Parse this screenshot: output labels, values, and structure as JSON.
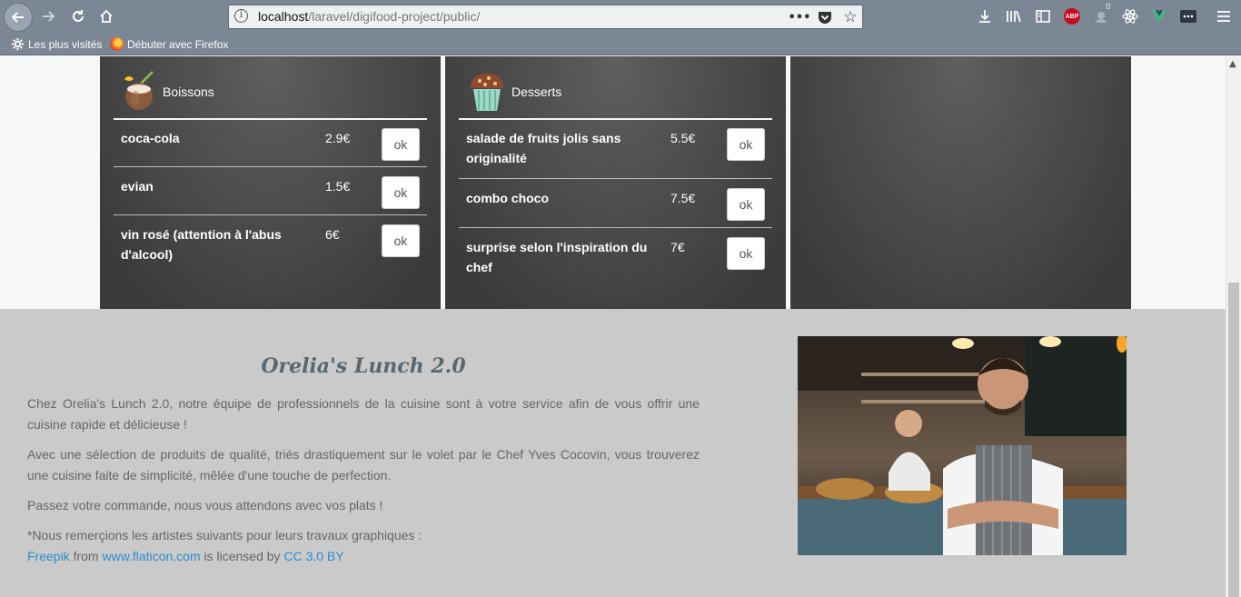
{
  "browser": {
    "url_host": "localhost",
    "url_path": "/laravel/digifood-project/public/",
    "url_actions": "•••",
    "bookmarks": [
      "Les plus visités",
      "Débuter avec Firefox"
    ],
    "abp_label": "ABP",
    "badge_count": "0"
  },
  "menu": {
    "boissons": {
      "title": "Boissons",
      "items": [
        {
          "name": "coca-cola",
          "price": "2.9€",
          "button": "ok"
        },
        {
          "name": "evian",
          "price": "1.5€",
          "button": "ok"
        },
        {
          "name": "vin rosé (attention à l'abus d'alcool)",
          "price": "6€",
          "button": "ok"
        }
      ]
    },
    "desserts": {
      "title": "Desserts",
      "items": [
        {
          "name": "salade de fruits jolis sans originalité",
          "price": "5.5€",
          "button": "ok"
        },
        {
          "name": "combo choco",
          "price": "7.5€",
          "button": "ok"
        },
        {
          "name": "surprise selon l'inspiration du chef",
          "price": "7€",
          "button": "ok"
        }
      ]
    }
  },
  "footer": {
    "brand": "Orelia's Lunch 2.0",
    "paragraphs": [
      "Chez Orelia's Lunch 2.0, notre équipe de professionnels de la cuisine sont à votre service afin de vous offrir une cuisine rapide et délicieuse !",
      "Avec une sélection de produits de qualité, triés drastiquement sur le volet par le Chef Yves Cocovin, vous trouverez une cuisine faite de simplicité, mêlée d'une touche de perfection.",
      "Passez votre commande, nous vous attendons avec vos plats !"
    ],
    "credit_intro": "*Nous remerçions les artistes suivants pour leurs travaux graphiques :",
    "credit_author": "Freepik",
    "credit_from": " from ",
    "credit_site": "www.flaticon.com",
    "credit_licensed": " is licensed by ",
    "credit_license": "CC 3.0 BY"
  },
  "colors": {
    "chrome": "#7b8794",
    "panel": "#3f3f3f",
    "footer_bg": "#cacaca",
    "link": "#2b8dd0"
  }
}
